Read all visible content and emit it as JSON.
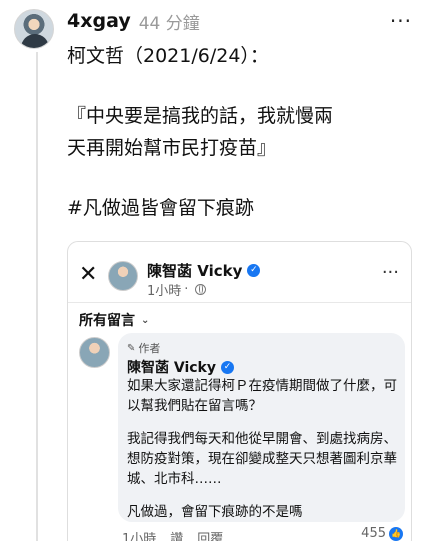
{
  "post": {
    "username": "4xgay",
    "time_ago": "44 分鐘",
    "more": "···",
    "lines": [
      "柯文哲（2021/6/24）：",
      "『中央要是搞我的話，我就慢兩",
      "天再開始幫市民打疫苗』",
      "#凡做過皆會留下痕跡"
    ]
  },
  "embed": {
    "close_icon": "✕",
    "page_name": "陳智菡 Vicky",
    "posted_time": "1小時",
    "more": "···",
    "filter_label": "所有留言",
    "comment": {
      "author_badge": "作者",
      "name": "陳智菡 Vicky",
      "paragraphs": [
        "如果大家還記得柯Ｐ在疫情期間做了什麼，可以幫我們貼在留言嗎？",
        "我記得我們每天和他從早開會、到處找病房、想防疫對策，現在卻變成整天只想著圖利京華城、北市科……",
        "凡做過，會留下痕跡的不是嗎"
      ],
      "time": "1小時",
      "like_label": "讚",
      "reply_label": "回覆",
      "reaction_count": "455"
    }
  },
  "colors": {
    "facebook_blue": "#1877f2",
    "bubble_bg": "#f0f2f5",
    "muted_text": "#9a9a9a"
  }
}
